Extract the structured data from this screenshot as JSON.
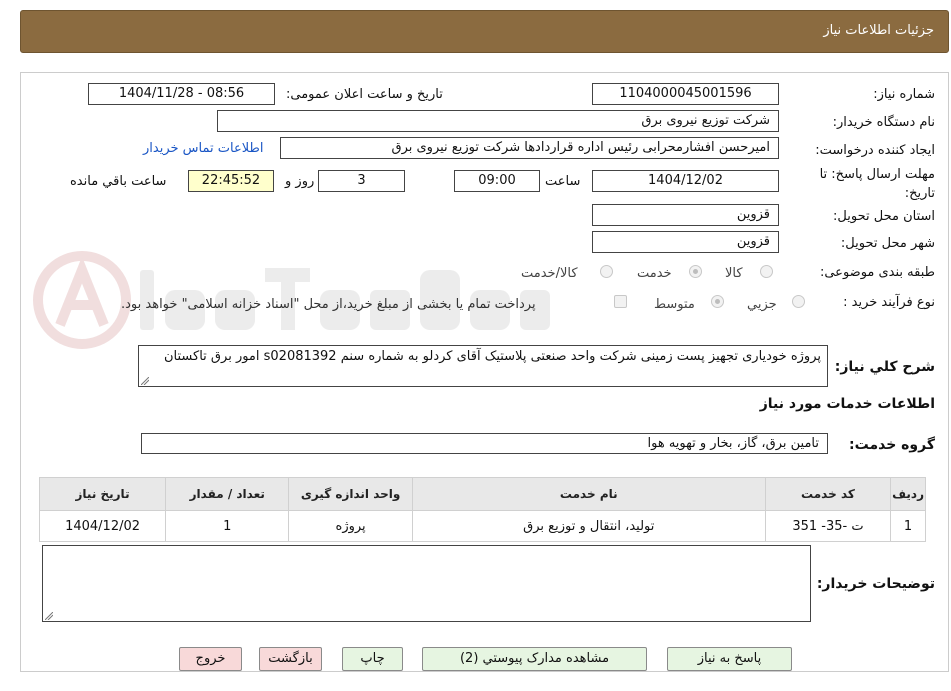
{
  "header": {
    "title": "جزئیات اطلاعات نیاز"
  },
  "form": {
    "need_number": {
      "label": "شماره نیاز:",
      "value": "1104000045001596"
    },
    "announce_datetime": {
      "label": "تاریخ و ساعت اعلان عمومی:",
      "value": "1404/11/28 - 08:56"
    },
    "buyer_org": {
      "label": "نام دستگاه خریدار:",
      "value": "شرکت توزیع نیروی برق"
    },
    "requester": {
      "label": "ایجاد کننده درخواست:",
      "value": "امیرحسن افشارمحرابی رئیس اداره قراردادها شرکت توزیع نیروی برق"
    },
    "contact_link": "اطلاعات تماس خریدار",
    "deadline": {
      "label": "مهلت ارسال پاسخ: تا تاریخ:",
      "date": "1404/12/02",
      "time_label": "ساعت",
      "time": "09:00",
      "days": "3",
      "days_label": "روز و",
      "remaining": "22:45:52",
      "remaining_label": "ساعت باقي مانده"
    },
    "province": {
      "label": "استان محل تحویل:",
      "value": "قزوین"
    },
    "city": {
      "label": "شهر محل تحویل:",
      "value": "قزوین"
    },
    "category": {
      "label": "طبقه بندی موضوعی:",
      "options": [
        "کالا",
        "خدمت",
        "کالا/خدمت"
      ],
      "selected": "خدمت"
    },
    "purchase_type": {
      "label": "نوع فرآیند خرید :",
      "options": [
        "جزیي",
        "متوسط"
      ],
      "selected": "متوسط",
      "payment_note": "پرداخت تمام یا بخشی از مبلغ خرید،از محل \"اسناد خزانه اسلامی\" خواهد بود."
    },
    "description": {
      "label": "شرح کلي نياز:",
      "value": "پروژه خودیاری تجهیز پست زمینی شرکت واحد صنعتی پلاستیک آقای کردلو به شماره سنم s02081392 امور برق تاکستان"
    }
  },
  "services": {
    "section_title": "اطلاعات خدمات مورد نياز",
    "group_label": "گروه خدمت:",
    "group_value": "تامین برق، گاز، بخار و تهویه هوا",
    "columns": [
      "ردیف",
      "کد خدمت",
      "نام خدمت",
      "واحد اندازه گیری",
      "تعداد / مقدار",
      "تاریخ نیاز"
    ],
    "rows": [
      [
        "1",
        "ت -35- 351",
        "تولید، انتقال و توزیع برق",
        "پروژه",
        "1",
        "1404/12/02"
      ]
    ]
  },
  "buyer_notes": {
    "label": "توضیحات خریدار:",
    "value": ""
  },
  "buttons": {
    "reply": "پاسخ به نیاز",
    "attachments": "مشاهده مدارک پیوستي (2)",
    "print": "چاپ",
    "back": "بازگشت",
    "exit": "خروج"
  },
  "colors": {
    "header_bg": "#8b6b40",
    "remaining_bg": "#ffffcc",
    "button_green": "#e6f5e1",
    "button_red": "#f8d9d9",
    "link": "#1a56c5"
  }
}
